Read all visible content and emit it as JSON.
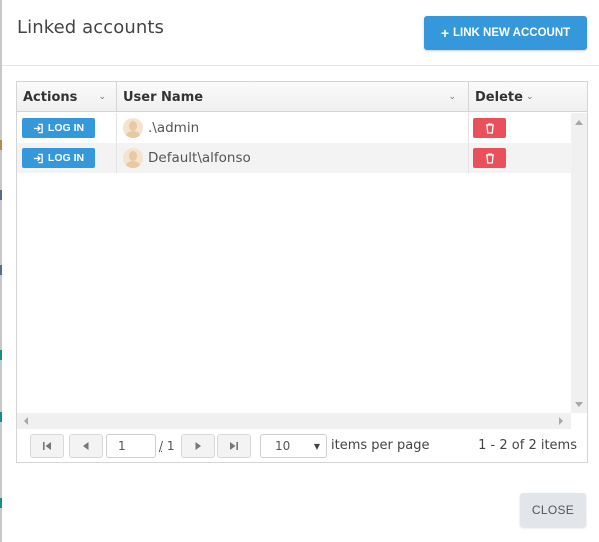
{
  "dialog": {
    "title": "Linked accounts",
    "link_new_account_label": "LINK NEW ACCOUNT",
    "close_label": "CLOSE"
  },
  "grid": {
    "columns": [
      {
        "label": "Actions"
      },
      {
        "label": "User Name"
      },
      {
        "label": "Delete"
      }
    ],
    "rows": [
      {
        "action_label": "LOG IN",
        "user_name": ".\\admin"
      },
      {
        "action_label": "LOG IN",
        "user_name": "Default\\alfonso"
      }
    ]
  },
  "pager": {
    "current_page": "1",
    "total_pages": "1",
    "page_of_prefix": "/",
    "items_per_page": "10",
    "items_per_page_label": "items per page",
    "range_text": "1 - 2 of 2 items"
  },
  "icons": {
    "link_new": "plus-icon",
    "login": "sign-in-icon",
    "delete": "trash-icon",
    "avatar": "user-avatar-icon"
  },
  "colors": {
    "primary": "#3498db",
    "danger": "#e8505b",
    "close_button_bg": "#e2e6ea"
  }
}
